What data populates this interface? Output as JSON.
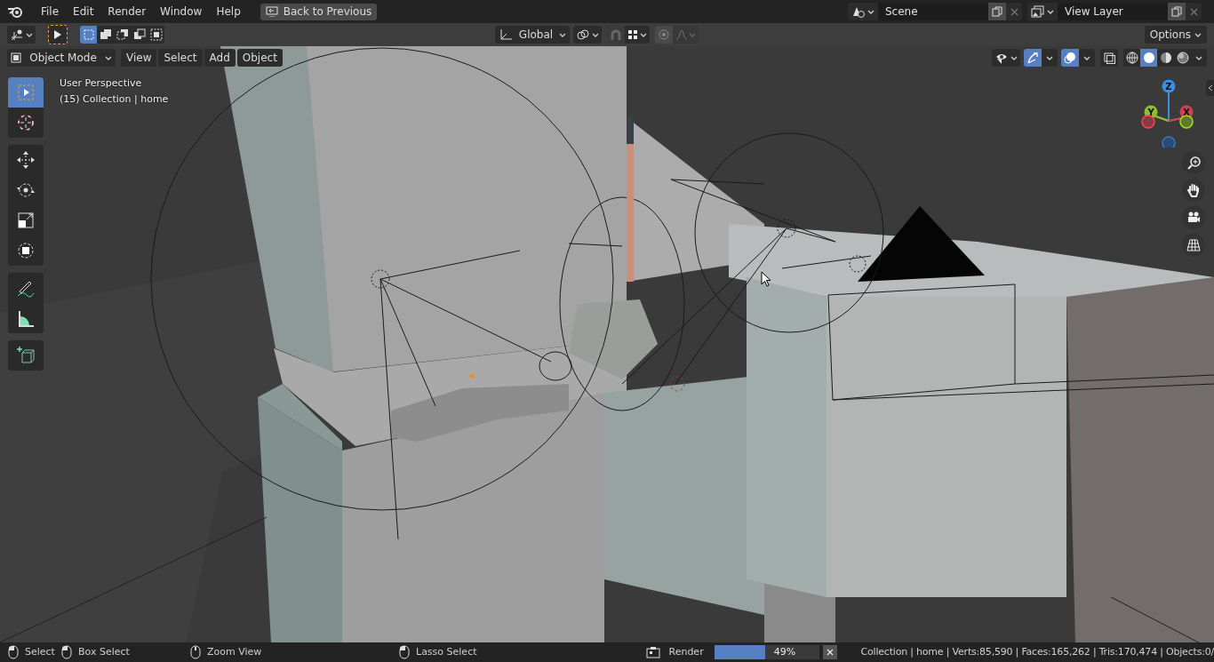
{
  "menu": [
    "File",
    "Edit",
    "Render",
    "Window",
    "Help"
  ],
  "back_button": "Back to Previous",
  "scene": {
    "value": "Scene"
  },
  "view_layer": {
    "value": "View Layer"
  },
  "tool_header": {
    "select_modes": [
      {
        "kind": "set",
        "selected": true
      },
      {
        "kind": "extend",
        "selected": false
      },
      {
        "kind": "subtract",
        "selected": false
      },
      {
        "kind": "invert",
        "selected": false
      },
      {
        "kind": "intersect",
        "selected": false
      }
    ],
    "orientation": "Global",
    "options": "Options"
  },
  "viewport_header": {
    "mode": "Object Mode",
    "menus": [
      "View",
      "Select",
      "Add",
      "Object"
    ],
    "shading": [
      {
        "kind": "wireframe",
        "selected": false
      },
      {
        "kind": "solid",
        "selected": true
      },
      {
        "kind": "material",
        "selected": false
      },
      {
        "kind": "rendered",
        "selected": false
      }
    ]
  },
  "overlay_text": [
    "User Perspective",
    "(15) Collection | home"
  ],
  "tools": [
    {
      "kind": "select",
      "selected": true
    },
    {
      "kind": "cursor",
      "selected": false
    },
    {
      "kind": "move",
      "selected": false
    },
    {
      "kind": "rotate",
      "selected": false
    },
    {
      "kind": "scale",
      "selected": false
    },
    {
      "kind": "transform",
      "selected": false
    },
    {
      "kind": "annotate",
      "selected": false
    },
    {
      "kind": "measure",
      "selected": false
    },
    {
      "kind": "add_cube",
      "selected": false
    }
  ],
  "gizmo": {
    "z": "Z",
    "y": "Y",
    "x": "X"
  },
  "status_bar": {
    "hints": [
      "Select",
      "Box Select",
      "Zoom View",
      "Lasso Select"
    ],
    "render_label": "Render",
    "render_progress": {
      "level": 0.49
    },
    "render_percent": "49%",
    "stats": "Collection | home | Verts:85,590 | Faces:165,262 | Tris:170,474 | Objects:0/"
  }
}
